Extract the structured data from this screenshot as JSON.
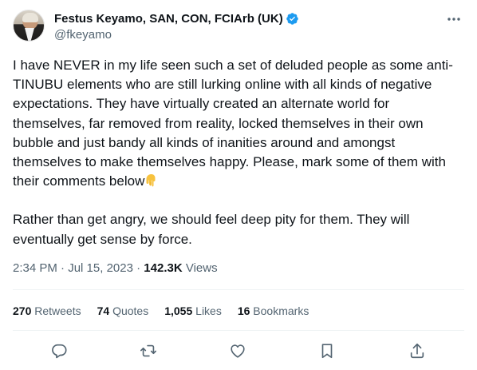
{
  "author": {
    "display_name": "Festus Keyamo, SAN, CON, FCIArb (UK)",
    "handle": "@fkeyamo",
    "verified": true
  },
  "tweet": {
    "paragraph_1": "I have NEVER in my life seen such a set of deluded people as some anti-TINUBU elements who are still lurking online with all kinds of negative expectations. They have virtually created an alternate world for themselves, far removed from reality, locked themselves in their own bubble and just bandy all kinds of inanities around and amongst themselves to make themselves happy. Please, mark some of them with their comments below",
    "paragraph_1_emoji": "backhand-index-pointing-down",
    "paragraph_2": "Rather than get angry, we should feel deep pity for them. They will eventually get sense by force."
  },
  "meta": {
    "time": "2:34 PM",
    "separator": " · ",
    "date": "Jul 15, 2023",
    "views_count": "142.3K",
    "views_label": " Views"
  },
  "stats": {
    "retweets_count": "270",
    "retweets_label": " Retweets",
    "quotes_count": "74",
    "quotes_label": " Quotes",
    "likes_count": "1,055",
    "likes_label": " Likes",
    "bookmarks_count": "16",
    "bookmarks_label": " Bookmarks"
  },
  "icons": {
    "more": "more-horizontal-icon",
    "reply": "reply-icon",
    "retweet": "retweet-icon",
    "like": "heart-icon",
    "bookmark": "bookmark-icon",
    "share": "share-icon",
    "verified": "verified-badge-icon"
  },
  "colors": {
    "verified_blue": "#1d9bf0",
    "text_primary": "#0f1419",
    "text_secondary": "#536471",
    "divider": "#eff3f4"
  }
}
